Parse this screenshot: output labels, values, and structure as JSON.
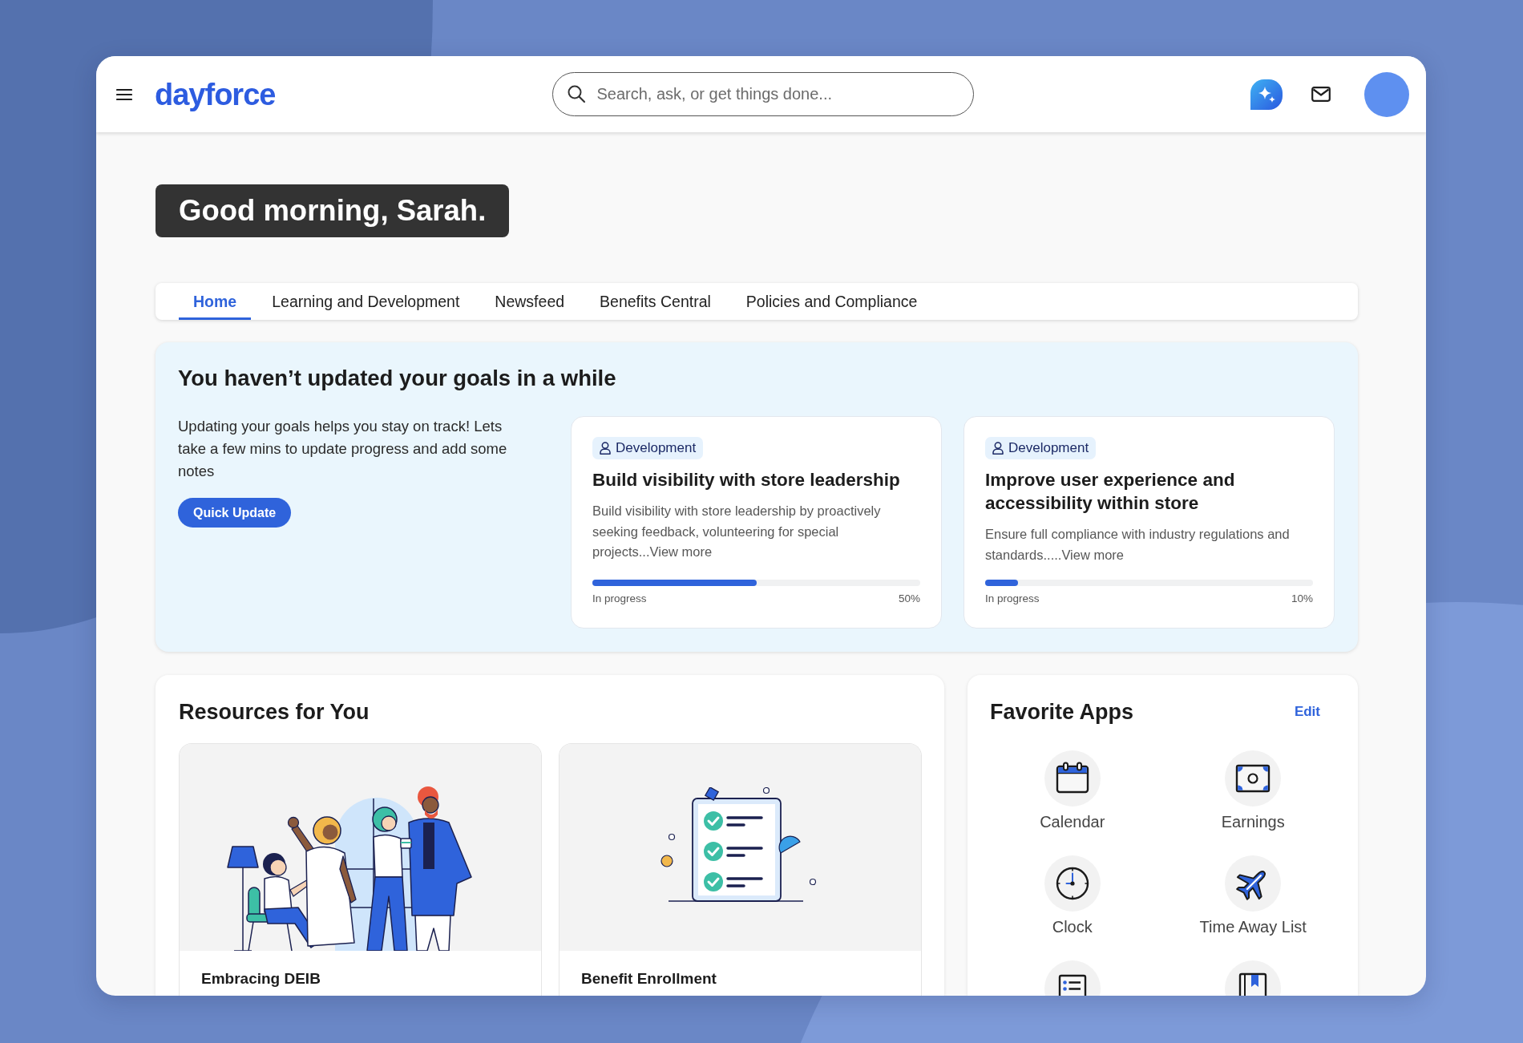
{
  "header": {
    "logo": "dayforce",
    "search": {
      "placeholder": "Search, ask, or get things done..."
    }
  },
  "greeting": "Good morning, Sarah.",
  "tabs": [
    {
      "label": "Home",
      "selected": true
    },
    {
      "label": "Learning and Development",
      "selected": false
    },
    {
      "label": "Newsfeed",
      "selected": false
    },
    {
      "label": "Benefits Central",
      "selected": false
    },
    {
      "label": "Policies and Compliance",
      "selected": false
    }
  ],
  "goals_reminder": {
    "title": "You haven’t updated your goals in a while",
    "text": "Updating your goals helps you stay on track! Lets take a few mins to update progress and add some notes",
    "button": "Quick Update",
    "goals": [
      {
        "tag": "Development",
        "title": "Build visibility with store leadership",
        "description": "Build visibility with store leadership by proactively seeking feedback, volunteering for special projects...View more",
        "status": "In progress",
        "level": 0.5,
        "percent": "50%"
      },
      {
        "tag": "Development",
        "title": "Improve user experience and accessibility within store",
        "description": "Ensure full compliance with industry regulations and standards.....View more",
        "status": "In progress",
        "level": 0.1,
        "percent": "10%"
      }
    ]
  },
  "resources": {
    "title": "Resources for You",
    "items": [
      {
        "kind": "people",
        "title": "Embracing DEIB"
      },
      {
        "kind": "checklist",
        "title": "Benefit Enrollment"
      }
    ]
  },
  "favorite_apps": {
    "title": "Favorite Apps",
    "edit": "Edit",
    "apps": [
      {
        "kind": "calendar",
        "label": "Calendar"
      },
      {
        "kind": "banknote",
        "label": "Earnings"
      },
      {
        "kind": "clock",
        "label": "Clock"
      },
      {
        "kind": "airplane",
        "label": "Time Away List"
      },
      {
        "kind": "list"
      },
      {
        "kind": "bookmark"
      }
    ]
  }
}
